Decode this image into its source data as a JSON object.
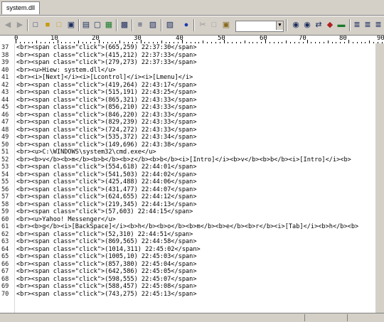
{
  "window": {
    "tab_label": "system.dll"
  },
  "toolbar": {
    "icons": [
      "back-arrow-icon",
      "forward-arrow-icon",
      "new-file-icon",
      "open-folder-icon",
      "open-file-icon",
      "save-icon",
      "print-icon",
      "print-preview-icon",
      "excel-export-icon",
      "page-icon",
      "wrap-lines-icon",
      "hex-view-icon",
      "text-format-icon",
      "browser-icon",
      "cut-icon",
      "copy-icon",
      "paste-icon",
      "find-icon",
      "find-next-icon",
      "replace-icon",
      "bookmark-icon",
      "justify-icon",
      "align-left-icon",
      "align-center-icon",
      "align-right-icon"
    ],
    "font_select": {
      "value": ""
    }
  },
  "ruler": {
    "marks": [
      "0",
      "10",
      "20",
      "30",
      "40",
      "50",
      "60",
      "70",
      "80",
      "90"
    ]
  },
  "editor": {
    "lines": [
      {
        "num": "37",
        "text": "<br><span class=\"click\">(665,259) 22:37:30</span>"
      },
      {
        "num": "38",
        "text": "<br><span class=\"click\">(415,212) 22:37:33</span>"
      },
      {
        "num": "39",
        "text": "<br><span class=\"click\">(279,273) 22:37:33</span>"
      },
      {
        "num": "40",
        "text": "<br><u>Hiew: system.dll</u>"
      },
      {
        "num": "41",
        "text": "<br><i>[Next]</i><i>[Lcontrol]</i><i>[Lmenu]</i>"
      },
      {
        "num": "42",
        "text": "<br><span class=\"click\">(419,264) 22:43:17</span>"
      },
      {
        "num": "43",
        "text": "<br><span class=\"click\">(515,191) 22:43:25</span>"
      },
      {
        "num": "44",
        "text": "<br><span class=\"click\">(865,321) 22:43:33</span>"
      },
      {
        "num": "45",
        "text": "<br><span class=\"click\">(856,210) 22:43:33</span>"
      },
      {
        "num": "46",
        "text": "<br><span class=\"click\">(846,220) 22:43:33</span>"
      },
      {
        "num": "47",
        "text": "<br><span class=\"click\">(829,239) 22:43:33</span>"
      },
      {
        "num": "48",
        "text": "<br><span class=\"click\">(724,272) 22:43:33</span>"
      },
      {
        "num": "49",
        "text": "<br><span class=\"click\">(535,372) 22:43:34</span>"
      },
      {
        "num": "50",
        "text": "<br><span class=\"click\">(149,696) 22:43:38</span>"
      },
      {
        "num": "51",
        "text": "<br><u>C:\\WINDOWS\\system32\\cmd.exe</u>"
      },
      {
        "num": "52",
        "text": "<br><b>v</b><b>m</b><b>b</b><b>z</b><b>b</b><i>[Intro]</i><b>v</b><b>b</b><i>[Intro]</i><b>"
      },
      {
        "num": "53",
        "text": "<br><span class=\"click\">(554,618) 22:44:01</span>"
      },
      {
        "num": "54",
        "text": "<br><span class=\"click\">(541,503) 22:44:02</span>"
      },
      {
        "num": "55",
        "text": "<br><span class=\"click\">(425,488) 22:44:06</span>"
      },
      {
        "num": "56",
        "text": "<br><span class=\"click\">(431,477) 22:44:07</span>"
      },
      {
        "num": "57",
        "text": "<br><span class=\"click\">(624,655) 22:44:12</span>"
      },
      {
        "num": "58",
        "text": "<br><span class=\"click\">(219,345) 22:44:13</span>"
      },
      {
        "num": "59",
        "text": "<br><span class=\"click\">(57,603) 22:44:15</span>"
      },
      {
        "num": "60",
        "text": "<br><u>Yahoo! Messenger</u>"
      },
      {
        "num": "61",
        "text": "<br><b>g</b><i>[BackSpace]</i><b>h</b><b>o</b><b>m</b><b>e</b><b>r</b><i>[Tab]</i><b>h</b><b>"
      },
      {
        "num": "62",
        "text": "<br><span class=\"click\">(52,310) 22:44:51</span>"
      },
      {
        "num": "63",
        "text": "<br><span class=\"click\">(869,565) 22:44:58</span>"
      },
      {
        "num": "64",
        "text": "<br><span class=\"click\">(1014,311) 22:45:02</span>"
      },
      {
        "num": "65",
        "text": "<br><span class=\"click\">(1005,10) 22:45:03</span>"
      },
      {
        "num": "66",
        "text": "<br><span class=\"click\">(857,380) 22:45:04</span>"
      },
      {
        "num": "67",
        "text": "<br><span class=\"click\">(642,586) 22:45:05</span>"
      },
      {
        "num": "68",
        "text": "<br><span class=\"click\">(598,555) 22:45:07</span>"
      },
      {
        "num": "69",
        "text": "<br><span class=\"click\">(588,457) 22:45:08</span>"
      },
      {
        "num": "70",
        "text": "<br><span class=\"click\">(743,275) 22:45:13</span>"
      }
    ]
  }
}
